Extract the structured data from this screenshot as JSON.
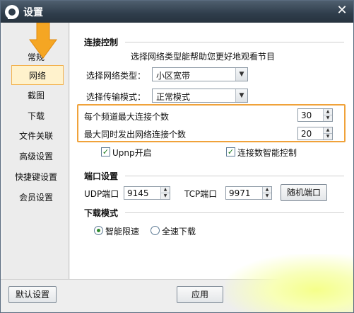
{
  "window": {
    "title": "设置"
  },
  "sidebar": {
    "items": [
      {
        "label": "常规",
        "active": false
      },
      {
        "label": "网络",
        "active": true
      },
      {
        "label": "截图",
        "active": false
      },
      {
        "label": "下载",
        "active": false
      },
      {
        "label": "文件关联",
        "active": false
      },
      {
        "label": "高级设置",
        "active": false
      },
      {
        "label": "快捷键设置",
        "active": false
      },
      {
        "label": "会员设置",
        "active": false
      }
    ]
  },
  "connection": {
    "title": "连接控制",
    "hint": "选择网络类型能帮助您更好地观看节目",
    "network_type_label": "选择网络类型：",
    "network_type_value": "小区宽带",
    "transfer_mode_label": "选择传输模式：",
    "transfer_mode_value": "正常模式",
    "max_conn_per_channel_label": "每个频道最大连接个数",
    "max_conn_per_channel_value": "30",
    "max_simultaneous_label": "最大同时发出网络连接个数",
    "max_simultaneous_value": "20",
    "upnp_label": "Upnp开启",
    "upnp_checked": true,
    "smart_conn_label": "连接数智能控制",
    "smart_conn_checked": true
  },
  "ports": {
    "title": "端口设置",
    "udp_label": "UDP端口",
    "udp_value": "9145",
    "tcp_label": "TCP端口",
    "tcp_value": "9971",
    "random_button": "随机端口"
  },
  "download_mode": {
    "title": "下载模式",
    "smart_label": "智能限速",
    "full_label": "全速下载",
    "selected": "智能限速"
  },
  "footer": {
    "default_button": "默认设置",
    "apply_button": "应用"
  },
  "colors": {
    "highlight": "#f0a23a",
    "active_bg": "#fff2cc",
    "arrow": "#f5a623"
  }
}
